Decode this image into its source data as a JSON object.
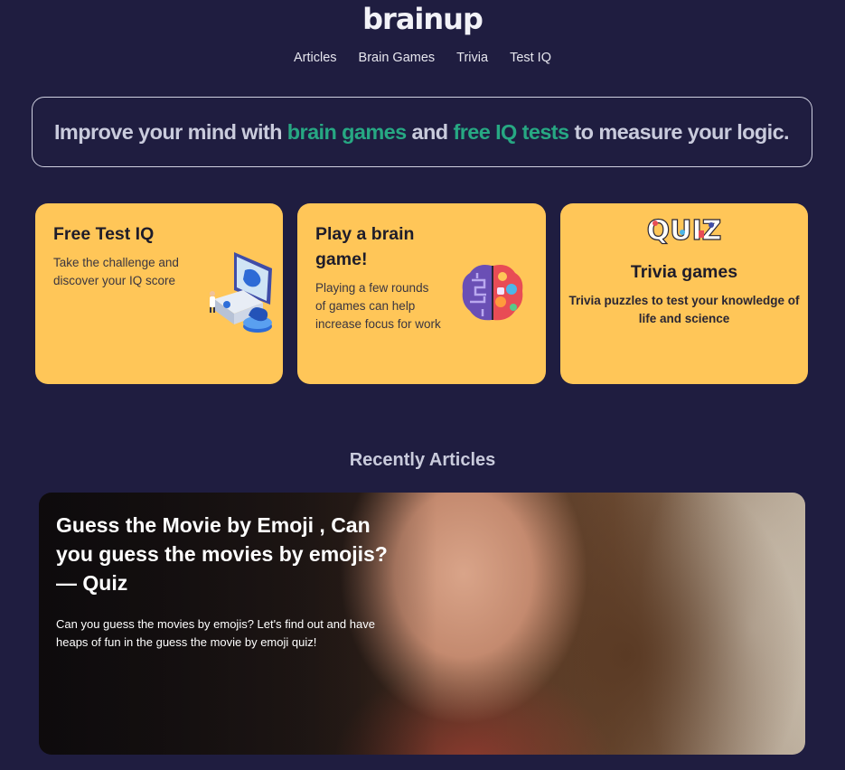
{
  "header": {
    "logo": "brainup",
    "nav": [
      "Articles",
      "Brain Games",
      "Trivia",
      "Test IQ"
    ]
  },
  "hero": {
    "part1": "Improve your mind with ",
    "accent1": "brain games",
    "part2": " and ",
    "accent2": "free IQ tests",
    "part3": " to measure your logic."
  },
  "cards": [
    {
      "title": "Free Test IQ",
      "desc": "Take the challenge and discover your IQ score",
      "icon": "computer-brain-icon"
    },
    {
      "title": "Play a brain game!",
      "desc": "Playing a few rounds of games can help increase focus for work",
      "icon": "colorful-brain-icon"
    },
    {
      "title": "Trivia games",
      "desc": "Trivia puzzles to test your knowledge of life and science",
      "icon": "quiz-logo",
      "logo_text": "QUIZ"
    }
  ],
  "section": {
    "title": "Recently Articles"
  },
  "article": {
    "title": "Guess the Movie by Emoji , Can you guess the movies by emojis? — Quiz",
    "desc": "Can you guess the movies by emojis? Let's find out and have heaps of fun in the guess the movie by emoji quiz!"
  },
  "colors": {
    "background": "#1f1d40",
    "accent": "#27a883",
    "card": "#ffc658"
  }
}
